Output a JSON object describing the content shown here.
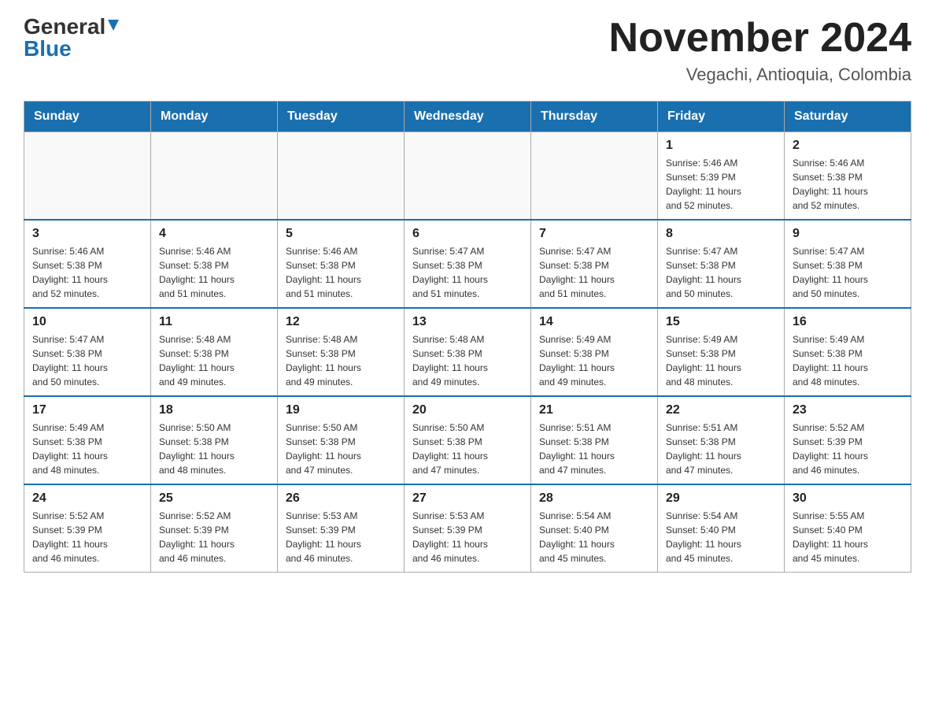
{
  "header": {
    "logo_general": "General",
    "logo_blue": "Blue",
    "title": "November 2024",
    "subtitle": "Vegachi, Antioquia, Colombia"
  },
  "weekdays": [
    "Sunday",
    "Monday",
    "Tuesday",
    "Wednesday",
    "Thursday",
    "Friday",
    "Saturday"
  ],
  "weeks": [
    [
      {
        "day": "",
        "info": ""
      },
      {
        "day": "",
        "info": ""
      },
      {
        "day": "",
        "info": ""
      },
      {
        "day": "",
        "info": ""
      },
      {
        "day": "",
        "info": ""
      },
      {
        "day": "1",
        "info": "Sunrise: 5:46 AM\nSunset: 5:39 PM\nDaylight: 11 hours\nand 52 minutes."
      },
      {
        "day": "2",
        "info": "Sunrise: 5:46 AM\nSunset: 5:38 PM\nDaylight: 11 hours\nand 52 minutes."
      }
    ],
    [
      {
        "day": "3",
        "info": "Sunrise: 5:46 AM\nSunset: 5:38 PM\nDaylight: 11 hours\nand 52 minutes."
      },
      {
        "day": "4",
        "info": "Sunrise: 5:46 AM\nSunset: 5:38 PM\nDaylight: 11 hours\nand 51 minutes."
      },
      {
        "day": "5",
        "info": "Sunrise: 5:46 AM\nSunset: 5:38 PM\nDaylight: 11 hours\nand 51 minutes."
      },
      {
        "day": "6",
        "info": "Sunrise: 5:47 AM\nSunset: 5:38 PM\nDaylight: 11 hours\nand 51 minutes."
      },
      {
        "day": "7",
        "info": "Sunrise: 5:47 AM\nSunset: 5:38 PM\nDaylight: 11 hours\nand 51 minutes."
      },
      {
        "day": "8",
        "info": "Sunrise: 5:47 AM\nSunset: 5:38 PM\nDaylight: 11 hours\nand 50 minutes."
      },
      {
        "day": "9",
        "info": "Sunrise: 5:47 AM\nSunset: 5:38 PM\nDaylight: 11 hours\nand 50 minutes."
      }
    ],
    [
      {
        "day": "10",
        "info": "Sunrise: 5:47 AM\nSunset: 5:38 PM\nDaylight: 11 hours\nand 50 minutes."
      },
      {
        "day": "11",
        "info": "Sunrise: 5:48 AM\nSunset: 5:38 PM\nDaylight: 11 hours\nand 49 minutes."
      },
      {
        "day": "12",
        "info": "Sunrise: 5:48 AM\nSunset: 5:38 PM\nDaylight: 11 hours\nand 49 minutes."
      },
      {
        "day": "13",
        "info": "Sunrise: 5:48 AM\nSunset: 5:38 PM\nDaylight: 11 hours\nand 49 minutes."
      },
      {
        "day": "14",
        "info": "Sunrise: 5:49 AM\nSunset: 5:38 PM\nDaylight: 11 hours\nand 49 minutes."
      },
      {
        "day": "15",
        "info": "Sunrise: 5:49 AM\nSunset: 5:38 PM\nDaylight: 11 hours\nand 48 minutes."
      },
      {
        "day": "16",
        "info": "Sunrise: 5:49 AM\nSunset: 5:38 PM\nDaylight: 11 hours\nand 48 minutes."
      }
    ],
    [
      {
        "day": "17",
        "info": "Sunrise: 5:49 AM\nSunset: 5:38 PM\nDaylight: 11 hours\nand 48 minutes."
      },
      {
        "day": "18",
        "info": "Sunrise: 5:50 AM\nSunset: 5:38 PM\nDaylight: 11 hours\nand 48 minutes."
      },
      {
        "day": "19",
        "info": "Sunrise: 5:50 AM\nSunset: 5:38 PM\nDaylight: 11 hours\nand 47 minutes."
      },
      {
        "day": "20",
        "info": "Sunrise: 5:50 AM\nSunset: 5:38 PM\nDaylight: 11 hours\nand 47 minutes."
      },
      {
        "day": "21",
        "info": "Sunrise: 5:51 AM\nSunset: 5:38 PM\nDaylight: 11 hours\nand 47 minutes."
      },
      {
        "day": "22",
        "info": "Sunrise: 5:51 AM\nSunset: 5:38 PM\nDaylight: 11 hours\nand 47 minutes."
      },
      {
        "day": "23",
        "info": "Sunrise: 5:52 AM\nSunset: 5:39 PM\nDaylight: 11 hours\nand 46 minutes."
      }
    ],
    [
      {
        "day": "24",
        "info": "Sunrise: 5:52 AM\nSunset: 5:39 PM\nDaylight: 11 hours\nand 46 minutes."
      },
      {
        "day": "25",
        "info": "Sunrise: 5:52 AM\nSunset: 5:39 PM\nDaylight: 11 hours\nand 46 minutes."
      },
      {
        "day": "26",
        "info": "Sunrise: 5:53 AM\nSunset: 5:39 PM\nDaylight: 11 hours\nand 46 minutes."
      },
      {
        "day": "27",
        "info": "Sunrise: 5:53 AM\nSunset: 5:39 PM\nDaylight: 11 hours\nand 46 minutes."
      },
      {
        "day": "28",
        "info": "Sunrise: 5:54 AM\nSunset: 5:40 PM\nDaylight: 11 hours\nand 45 minutes."
      },
      {
        "day": "29",
        "info": "Sunrise: 5:54 AM\nSunset: 5:40 PM\nDaylight: 11 hours\nand 45 minutes."
      },
      {
        "day": "30",
        "info": "Sunrise: 5:55 AM\nSunset: 5:40 PM\nDaylight: 11 hours\nand 45 minutes."
      }
    ]
  ]
}
